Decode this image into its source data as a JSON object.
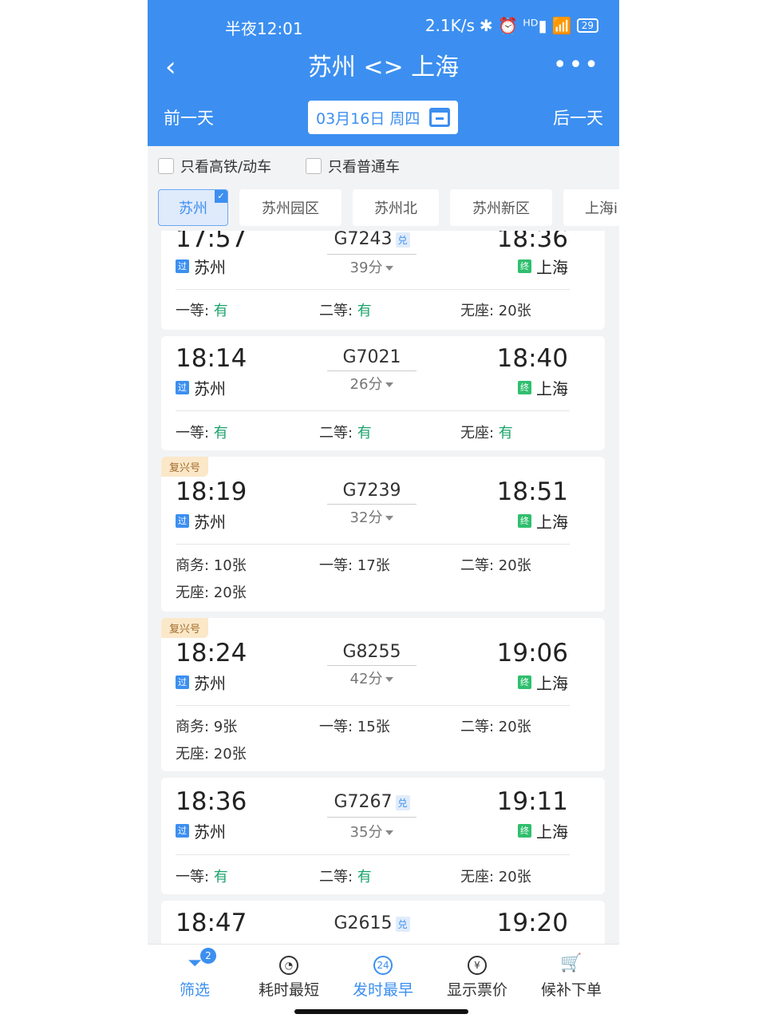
{
  "status_bar": {
    "time": "半夜12:01",
    "net_speed": "2.1K/s",
    "icons": "✱ ⏰ ᴴᴰ▮ 📶",
    "battery": "29"
  },
  "header": {
    "title": "苏州 <> 上海",
    "back_icon": "‹",
    "more_icon": "•••"
  },
  "date_bar": {
    "prev_label": "前一天",
    "date": "03月16日 周四",
    "next_label": "后一天"
  },
  "filters": {
    "high_speed_only": "只看高铁/动车",
    "normal_only": "只看普通车"
  },
  "stations": [
    {
      "label": "苏州",
      "selected": true
    },
    {
      "label": "苏州园区"
    },
    {
      "label": "苏州北"
    },
    {
      "label": "苏州新区"
    },
    {
      "label": "上海i"
    }
  ],
  "trains": [
    {
      "dep_time": "17:57",
      "dep_station": "苏州",
      "dep_tag": "过",
      "number": "G7243",
      "dui": "兑",
      "duration": "39分",
      "arr_time": "18:36",
      "arr_station": "上海",
      "arr_tag": "终",
      "seats": [
        {
          "label": "一等: ",
          "value": "有",
          "green": true
        },
        {
          "label": "二等: ",
          "value": "有",
          "green": true
        },
        {
          "label": "无座: ",
          "value": "20张"
        }
      ]
    },
    {
      "dep_time": "18:14",
      "dep_station": "苏州",
      "dep_tag": "过",
      "number": "G7021",
      "duration": "26分",
      "arr_time": "18:40",
      "arr_station": "上海",
      "arr_tag": "终",
      "seats": [
        {
          "label": "一等: ",
          "value": "有",
          "green": true
        },
        {
          "label": "二等: ",
          "value": "有",
          "green": true
        },
        {
          "label": "无座: ",
          "value": "有",
          "green": true
        }
      ]
    },
    {
      "badge": "复兴号",
      "dep_time": "18:19",
      "dep_station": "苏州",
      "dep_tag": "过",
      "number": "G7239",
      "duration": "32分",
      "arr_time": "18:51",
      "arr_station": "上海",
      "arr_tag": "终",
      "seats": [
        {
          "label": "商务: ",
          "value": "10张"
        },
        {
          "label": "一等: ",
          "value": "17张"
        },
        {
          "label": "二等: ",
          "value": "20张"
        },
        {
          "label": "无座: ",
          "value": "20张"
        }
      ]
    },
    {
      "badge": "复兴号",
      "dep_time": "18:24",
      "dep_station": "苏州",
      "dep_tag": "过",
      "number": "G8255",
      "duration": "42分",
      "arr_time": "19:06",
      "arr_station": "上海",
      "arr_tag": "终",
      "seats": [
        {
          "label": "商务: ",
          "value": "9张"
        },
        {
          "label": "一等: ",
          "value": "15张"
        },
        {
          "label": "二等: ",
          "value": "20张"
        },
        {
          "label": "无座: ",
          "value": "20张"
        }
      ]
    },
    {
      "dep_time": "18:36",
      "dep_station": "苏州",
      "dep_tag": "过",
      "number": "G7267",
      "dui": "兑",
      "duration": "35分",
      "arr_time": "19:11",
      "arr_station": "上海",
      "arr_tag": "终",
      "seats": [
        {
          "label": "一等: ",
          "value": "有",
          "green": true
        },
        {
          "label": "二等: ",
          "value": "有",
          "green": true
        },
        {
          "label": "无座: ",
          "value": "20张"
        }
      ]
    },
    {
      "dep_time": "18:47",
      "number": "G2615",
      "dui": "兑",
      "arr_time": "19:20"
    }
  ],
  "bottom_tabs": [
    {
      "label": "筛选",
      "icon": "filter-icon",
      "count": "2",
      "active": true
    },
    {
      "label": "耗时最短",
      "icon": "timer-icon"
    },
    {
      "label": "发时最早",
      "icon": "clock-24-icon",
      "active": true,
      "icon_text": "24"
    },
    {
      "label": "显示票价",
      "icon": "yen-icon",
      "icon_text": "¥"
    },
    {
      "label": "候补下单",
      "icon": "cart-icon"
    }
  ],
  "colors": {
    "primary": "#3c8ff0",
    "available_green": "#1aa36b",
    "pass_tag": "#3c8ff0",
    "end_tag": "#2fbf6e"
  }
}
